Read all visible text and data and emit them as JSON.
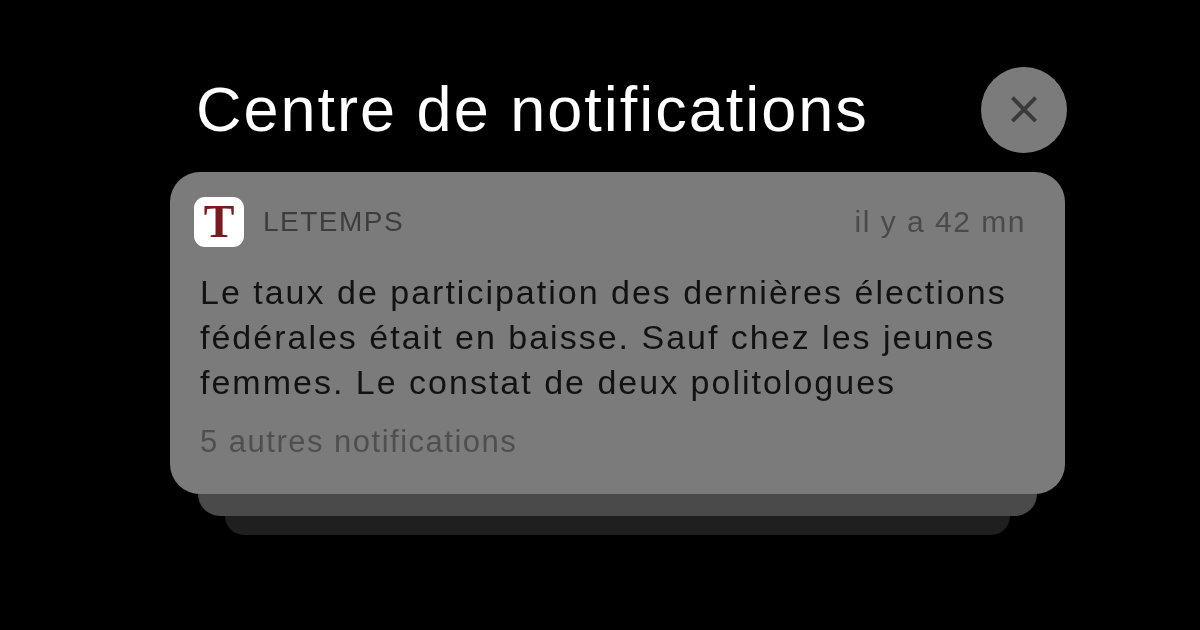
{
  "header": {
    "title": "Centre de notifications"
  },
  "close_button": {
    "label": "×"
  },
  "notification": {
    "app_icon_letter": "T",
    "app_name": "LETEMPS",
    "time": "il y a 42 mn",
    "body": "Le taux de participation des dernières élections fédérales était en baisse. Sauf chez les jeunes femmes. Le constat de deux politologues",
    "more": "5 autres notifications",
    "stacked": true
  }
}
